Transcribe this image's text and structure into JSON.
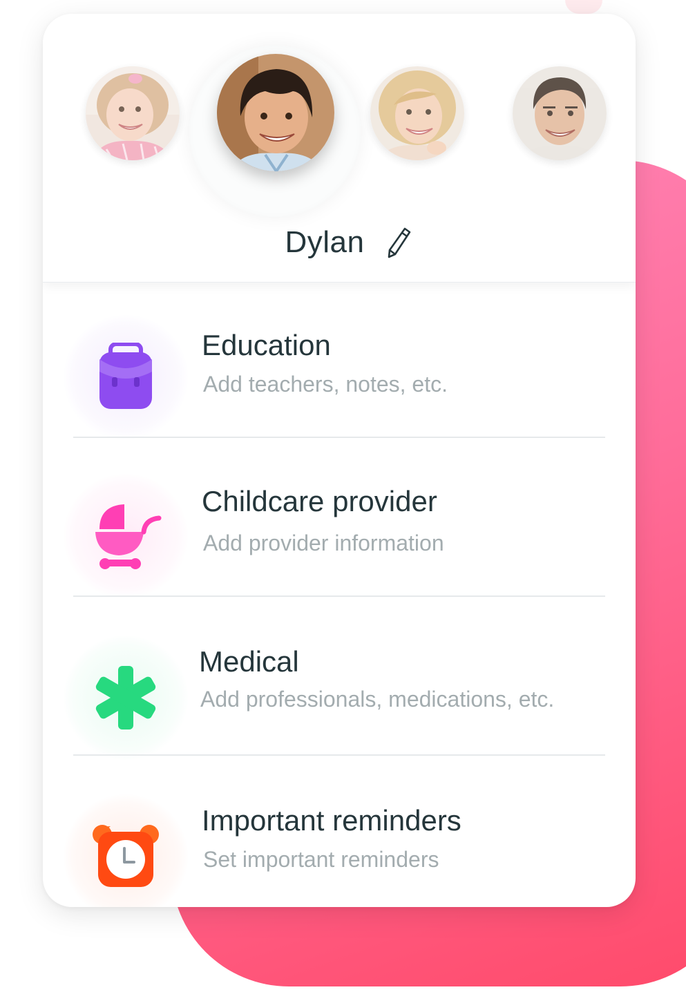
{
  "colors": {
    "accent_gradient_start": "#ff86b8",
    "accent_gradient_end": "#ff4a6a",
    "title_text": "#25363b",
    "subtitle_text": "#a3acaf",
    "education_icon": "#8e4cf0",
    "childcare_icon": "#ff3fb4",
    "medical_icon": "#27d97f",
    "reminders_icon": "#ff4a12"
  },
  "profile": {
    "name": "Dylan",
    "selected_index": 1,
    "avatars": [
      {
        "icon": "girl-avatar"
      },
      {
        "icon": "boy-avatar"
      },
      {
        "icon": "mother-avatar"
      },
      {
        "icon": "father-avatar"
      }
    ],
    "edit_icon": "pencil-icon"
  },
  "categories": [
    {
      "title": "Education",
      "subtitle": "Add teachers, notes, etc.",
      "icon": "backpack-icon"
    },
    {
      "title": "Childcare provider",
      "subtitle": "Add provider information",
      "icon": "stroller-icon"
    },
    {
      "title": "Medical",
      "subtitle": "Add professionals, medications, etc.",
      "icon": "medical-cross-icon"
    },
    {
      "title": "Important reminders",
      "subtitle": "Set important reminders",
      "icon": "alarm-clock-icon"
    }
  ]
}
